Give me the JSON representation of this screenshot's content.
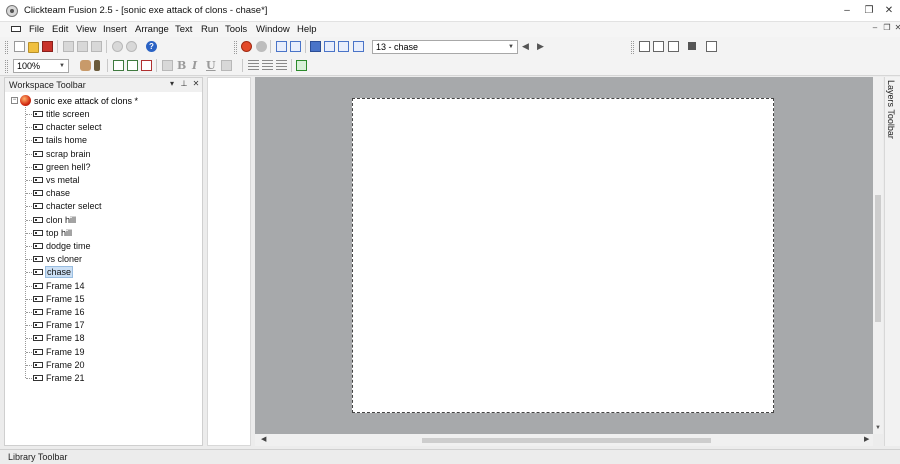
{
  "window": {
    "title": "Clickteam Fusion 2.5 - [sonic exe attack of clons - chase*]",
    "minimize_glyph": "–",
    "restore_glyph": "❐",
    "close_glyph": "✕"
  },
  "menu": {
    "items": [
      "File",
      "Edit",
      "View",
      "Insert",
      "Arrange",
      "Text",
      "Run",
      "Tools",
      "Window",
      "Help"
    ],
    "mdi_minimize": "–",
    "mdi_restore": "❐",
    "mdi_close": "✕"
  },
  "toolbar": {
    "frame_dropdown_value": "13 - chase",
    "zoom_value": "100%",
    "help_glyph": "?",
    "prev_frame_glyph": "◀",
    "next_frame_glyph": "▶",
    "bold_glyph": "B",
    "italic_glyph": "I",
    "underline_glyph": "U"
  },
  "workspace": {
    "title": "Workspace Toolbar",
    "pin_glyph": "⊥",
    "close_glyph": "✕",
    "menu_glyph": "▾",
    "expander_glyph": "−",
    "application_name": "sonic exe attack of clons *",
    "frames": [
      "title screen",
      "chacter select",
      "tails home",
      "scrap brain",
      "green hell?",
      "vs metal",
      "chase",
      "chacter select",
      "clon hill",
      "top hill",
      "dodge time",
      "vs cloner",
      "chase",
      "Frame 14",
      "Frame 15",
      "Frame 16",
      "Frame 17",
      "Frame 18",
      "Frame 19",
      "Frame 20",
      "Frame 21"
    ],
    "selected_frame_index": 12
  },
  "scrollbars": {
    "left_arrow": "◀",
    "right_arrow": "▶",
    "down_arrow": "▼"
  },
  "layers_toolbar": {
    "label": "Layers Toolbar"
  },
  "library_toolbar": {
    "label": "Library Toolbar"
  }
}
